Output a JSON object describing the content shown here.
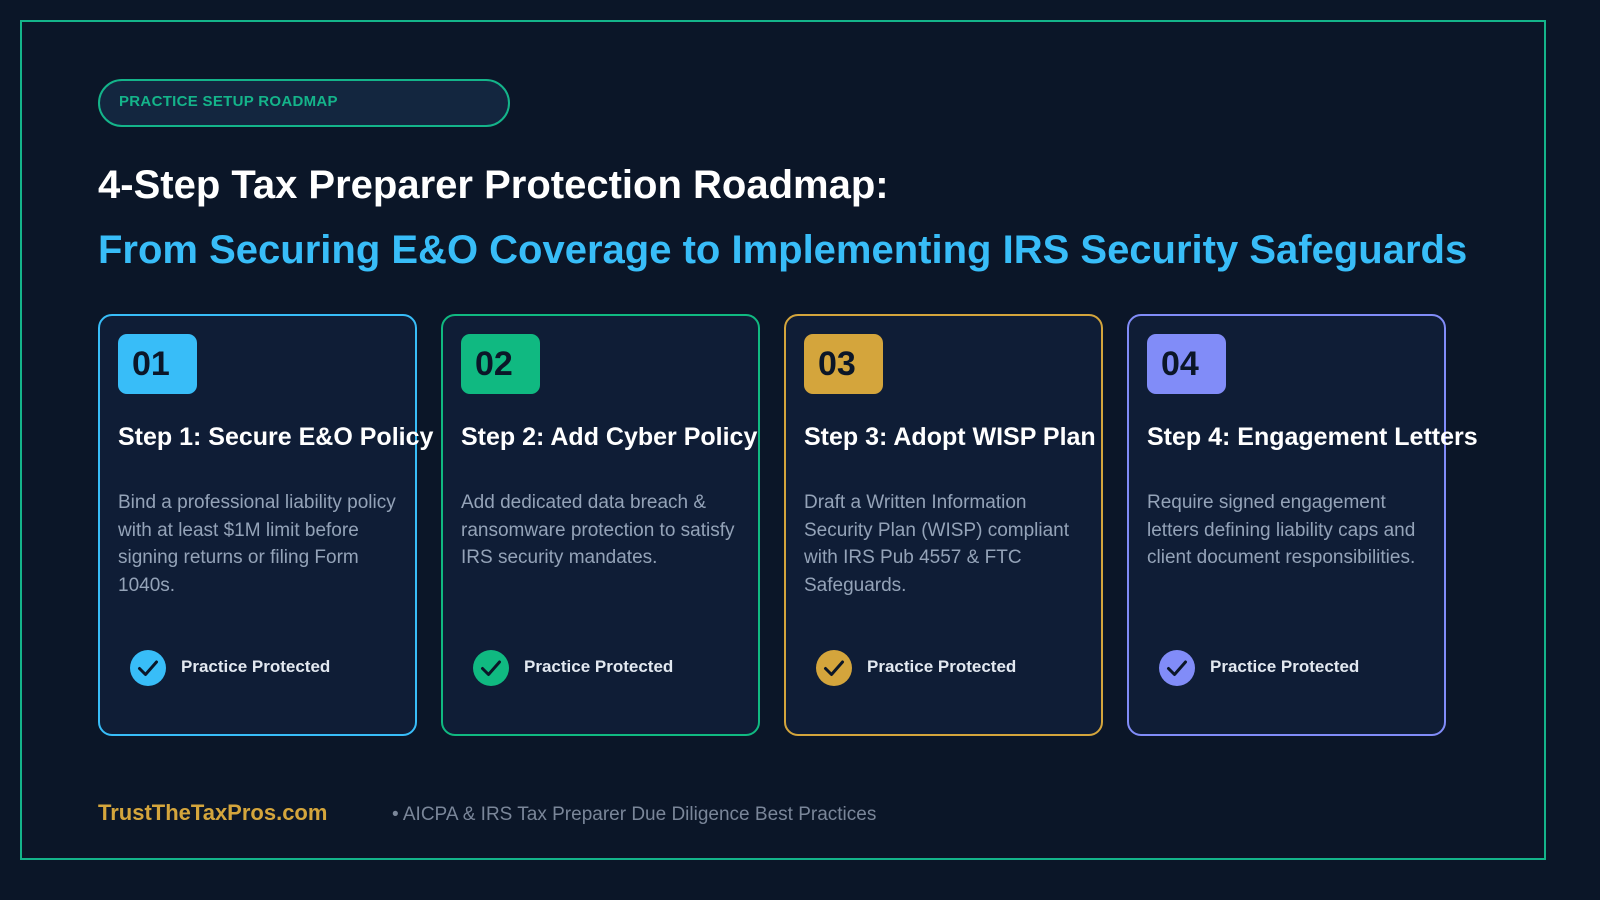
{
  "badge": "PRACTICE SETUP ROADMAP",
  "title": "4-Step Tax Preparer Protection Roadmap:",
  "subtitle": "From Securing E&O Coverage to Implementing IRS Security Safeguards",
  "cards": [
    {
      "number": "01",
      "title": "Step 1: Secure E&O Policy",
      "description": "Bind a professional liability policy with at least $1M limit before signing returns or filing Form 1040s.",
      "status": "Practice Protected",
      "color": "#38bdf8"
    },
    {
      "number": "02",
      "title": "Step 2: Add Cyber Policy",
      "description": "Add dedicated data breach & ransomware protection to satisfy IRS security mandates.",
      "status": "Practice Protected",
      "color": "#10b981"
    },
    {
      "number": "03",
      "title": "Step 3: Adopt WISP Plan",
      "description": "Draft a Written Information Security Plan (WISP) compliant with IRS Pub 4557 & FTC Safeguards.",
      "status": "Practice Protected",
      "color": "#d4a53c"
    },
    {
      "number": "04",
      "title": "Step 4: Engagement Letters",
      "description": "Require signed engagement letters defining liability caps and client document responsibilities.",
      "status": "Practice Protected",
      "color": "#818cf8"
    }
  ],
  "footer": {
    "brand": "TrustTheTaxPros.com",
    "note": "• AICPA & IRS Tax Preparer Due Diligence Best Practices"
  }
}
